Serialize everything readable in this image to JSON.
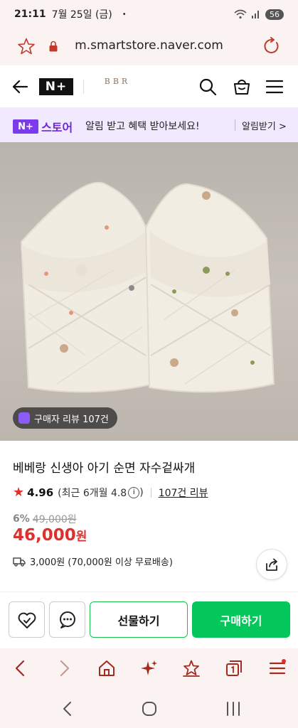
{
  "status": {
    "time": "21:11",
    "date": "7월 25일 (금)",
    "dot": "•",
    "battery": "56"
  },
  "browser": {
    "url": "m.smartstore.naver.com"
  },
  "header": {
    "nplus_logo": "N+",
    "brand_logo": "BBR",
    "icons": [
      "back-icon",
      "search-icon",
      "shopping-bag-icon",
      "hamburger-menu-icon"
    ]
  },
  "promo": {
    "logo_badge": "N+",
    "logo_text": "스토어",
    "message": "알림 받고 혜택 받아보세요!",
    "subscribe_label": "알림받기 >"
  },
  "hero": {
    "review_chip": "구매자 리뷰 107건"
  },
  "product": {
    "title": "베베랑 신생아 아기 순면 자수겉싸개",
    "rating": "4.96",
    "recent_rating": "(최근 6개월 4.8",
    "recent_close": ")",
    "info_glyph": "i",
    "review_count": "107건 리뷰",
    "discount_pct": "6%",
    "original_price": "49,000원",
    "price": "46,000",
    "price_unit": "원",
    "shipping": "3,000원 (70,000원 이상 무료배송)"
  },
  "actions": {
    "gift_label": "선물하기",
    "buy_label": "구매하기"
  },
  "colors": {
    "accent_green": "#03c75a",
    "price_red": "#e0302d",
    "promo_purple": "#7c3aed",
    "browser_bg": "#fbf3f2"
  }
}
